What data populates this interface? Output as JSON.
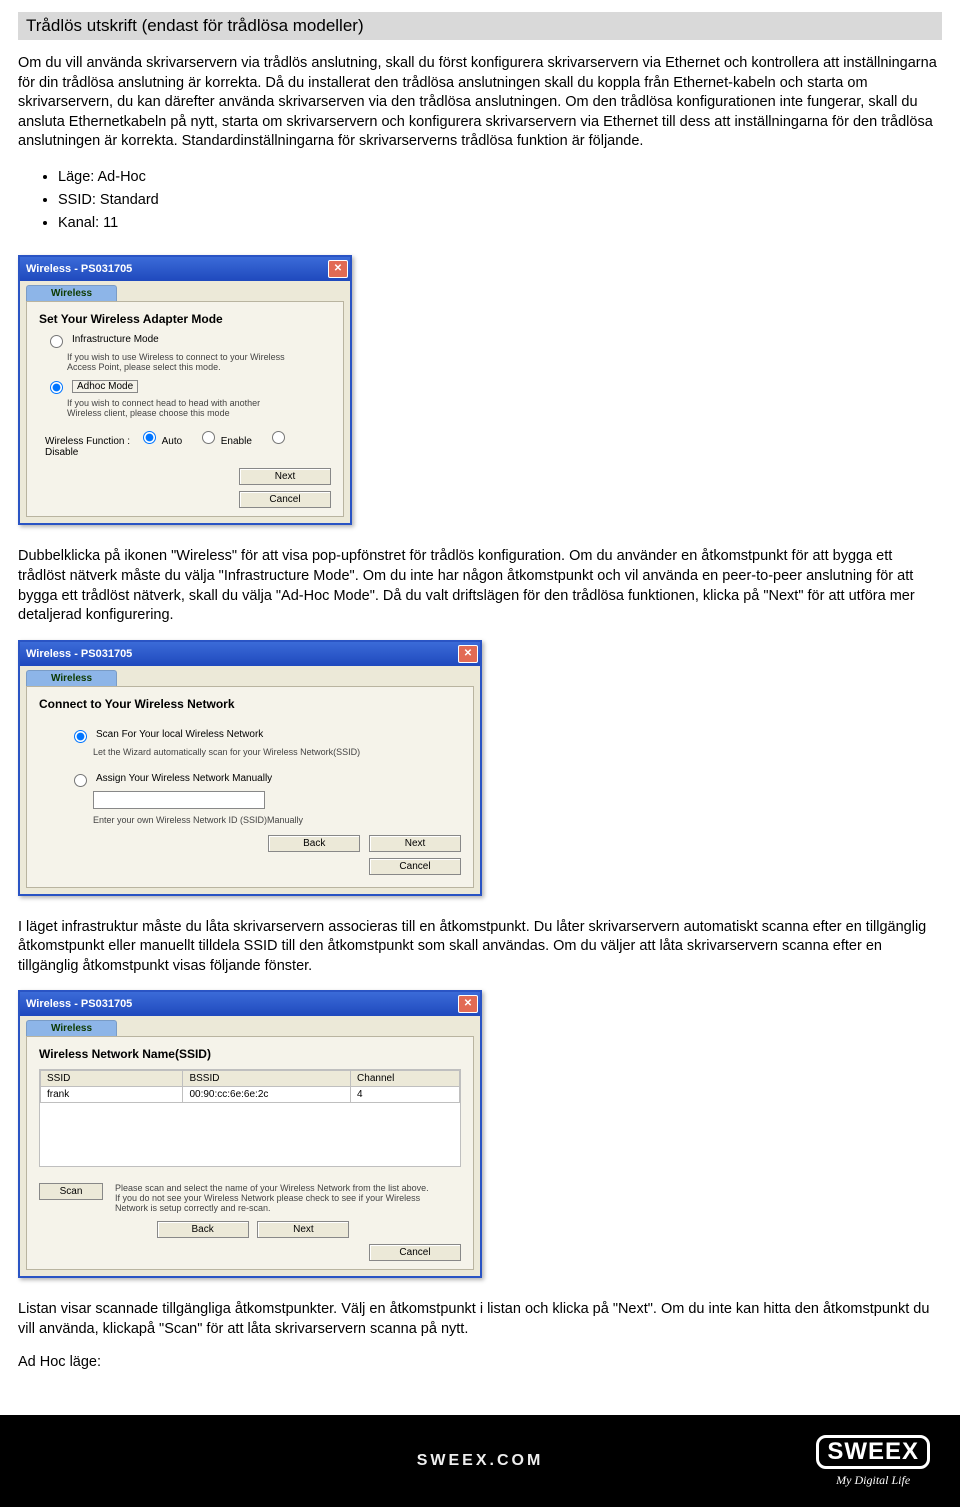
{
  "section_title": "Trådlös utskrift (endast för trådlösa modeller)",
  "intro_para": "Om du vill använda skrivarservern via trådlös anslutning, skall du först konfigurera skrivarservern via Ethernet och kontrollera att inställningarna för din trådlösa anslutning är korrekta. Då du installerat den trådlösa anslutningen skall du koppla från Ethernet-kabeln och starta om skrivarservern, du kan därefter använda skrivarserven via den trådlösa anslutningen.  Om den trådlösa konfigurationen inte fungerar, skall du ansluta Ethernetkabeln på nytt, starta om skrivarservern och konfigurera skrivarservern via Ethernet till dess att inställningarna för den trådlösa anslutningen är korrekta. Standardinställningarna för skrivarserverns trådlösa funktion är följande.",
  "defaults": [
    "Läge: Ad-Hoc",
    "SSID: Standard",
    "Kanal: 11"
  ],
  "dlg_title": "Wireless - PS031705",
  "tab_label": "Wireless",
  "dlg1": {
    "heading": "Set Your Wireless Adapter Mode",
    "opt1": "Infrastructure Mode",
    "hint1": "If you wish to use Wireless to connect to your Wireless Access Point, please select this mode.",
    "opt2": "Adhoc Mode",
    "hint2": "If you wish to connect head to head with another Wireless client, please choose this mode",
    "func_label": "Wireless Function :",
    "auto": "Auto",
    "enable": "Enable",
    "disable": "Disable",
    "next": "Next",
    "cancel": "Cancel"
  },
  "para2": "Dubbelklicka på ikonen \"Wireless\" för att visa pop-upfönstret för trådlös konfiguration. Om du använder en åtkomstpunkt för att bygga ett trådlöst nätverk måste du välja \"Infrastructure Mode\". Om du inte har någon åtkomstpunkt och vil använda en peer-to-peer anslutning för att bygga ett trådlöst nätverk, skall du välja \"Ad-Hoc Mode\". Då du valt driftslägen för den trådlösa funktionen, klicka på \"Next\" för att utföra mer detaljerad konfigurering.",
  "dlg2": {
    "heading": "Connect to Your Wireless Network",
    "opt1": "Scan For Your local Wireless Network",
    "hint1": "Let the Wizard automatically scan for your Wireless Network(SSID)",
    "opt2": "Assign Your Wireless Network Manually",
    "hint2": "Enter your own Wireless Network ID (SSID)Manually",
    "back": "Back",
    "next": "Next",
    "cancel": "Cancel"
  },
  "para3": "I läget infrastruktur måste du låta skrivarservern associeras till en åtkomstpunkt.  Du låter skrivarservern automatiskt scanna efter en tillgänglig åtkomstpunkt eller manuellt tilldela SSID till den åtkomstpunkt som skall användas. Om du väljer att låta skrivarservern scanna efter en tillgänglig åtkomstpunkt visas följande fönster.",
  "dlg3": {
    "heading": "Wireless Network Name(SSID)",
    "col_ssid": "SSID",
    "col_bssid": "BSSID",
    "col_ch": "Channel",
    "row_ssid": "frank",
    "row_bssid": "00:90:cc:6e:6e:2c",
    "row_ch": "4",
    "scan": "Scan",
    "note": "Please scan and select the name of your Wireless Network from the list above.\nIf you do not see your Wireless Network please check to see if your Wireless Network is setup correctly and re-scan.",
    "back": "Back",
    "next": "Next",
    "cancel": "Cancel"
  },
  "para4": "Listan visar scannade tillgängliga åtkomstpunkter.  Välj en åtkomstpunkt i listan och klicka på \"Next\". Om du inte kan hitta den åtkomstpunkt du vill använda, klickapå \"Scan\" för att låta skrivarservern scanna på nytt.",
  "para5": "Ad Hoc läge:",
  "footer": {
    "brand": "SWEEX",
    "tag": "My  Digital  Life",
    "center": "SWEEX.COM"
  }
}
